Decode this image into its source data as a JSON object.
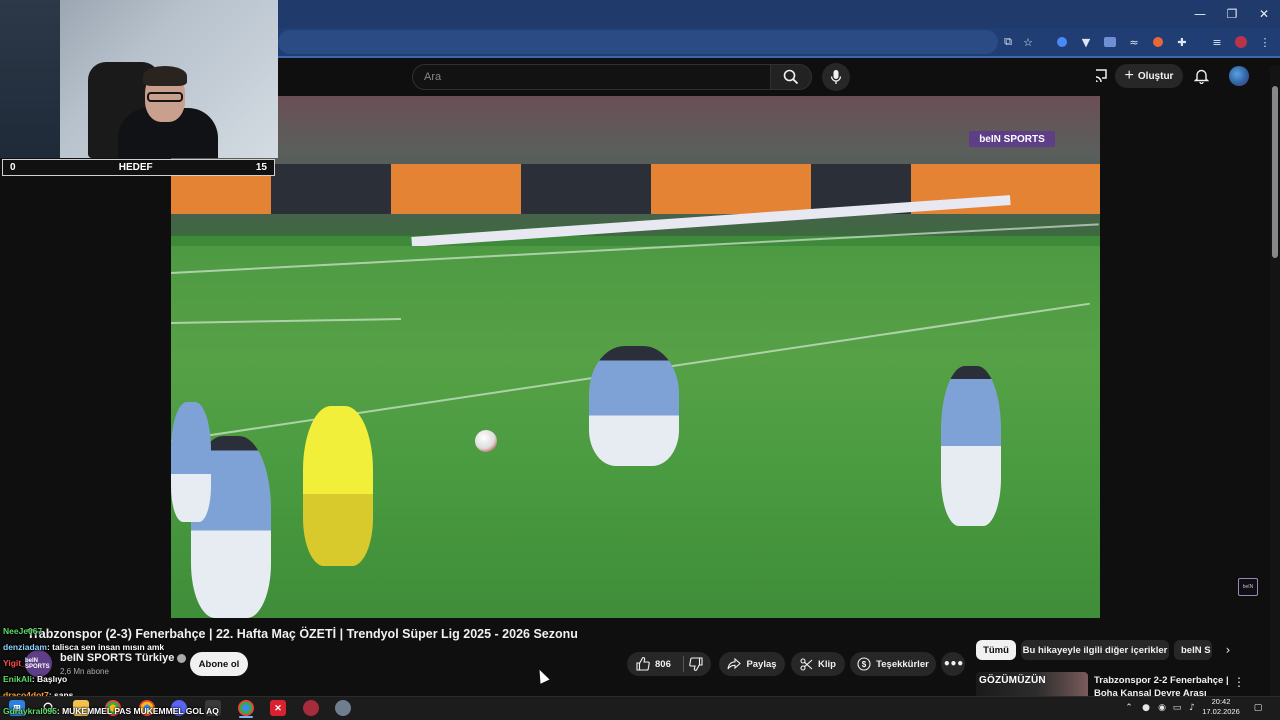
{
  "window": {
    "controls": [
      "—",
      "❐",
      "✕"
    ]
  },
  "youtube": {
    "search": {
      "placeholder": "Ara"
    },
    "create_label": "Oluştur"
  },
  "webcam": {
    "hedef": {
      "left": "0",
      "label": "HEDEF",
      "right": "15"
    }
  },
  "video": {
    "watermark": "beIN SPORTS",
    "title": "Trabzonspor (2-3) Fenerbahçe | 22. Hafta Maç ÖZETİ | Trendyol Süper Lig 2025 - 2026 Sezonu",
    "channel": {
      "name": "beIN SPORTS Türkiye",
      "subscribers": "2,6 Mn abone",
      "avatar_text": "beIN SPORTS",
      "subscribe_label": "Abone ol"
    },
    "actions": {
      "likes": "806",
      "share": "Paylaş",
      "clip": "Klip",
      "thanks": "Teşekkürler"
    }
  },
  "related": {
    "chips": [
      "Tümü",
      "Bu hikayeyle ilgili diğer içerikler",
      "beIN S"
    ],
    "items": [
      {
        "thumb_text": "GÖZÜMÜZÜN",
        "title": "Trabzonspor 2-2 Fenerbahçe | Boha Kansal Devre Arası"
      }
    ]
  },
  "chat": [
    {
      "user": "NeeJe067",
      "message": "",
      "color": "#5ddc6a"
    },
    {
      "user": "denziadam",
      "message": ": talisca sen insan mısın amk",
      "color": "#8fd3ff"
    },
    {
      "user": "Yigit_",
      "message": "",
      "color": "#ff4d4d"
    },
    {
      "user": "EnikAli",
      "message": ": Başlıyo",
      "color": "#5ddc6a"
    },
    {
      "user": "draco4dot7",
      "message": ": şans",
      "color": "#ff9f3a"
    },
    {
      "user": "Gdraykral095",
      "message": ": MUKEMMEL PAS MUKEMMEL GOL AQ",
      "color": "#5ddc6a"
    }
  ],
  "taskbar": {
    "time": "20:42",
    "date": "17.02.2026"
  },
  "colors": {
    "accent": "#3ea6ff",
    "youtube_bg": "#0f0f0f",
    "browser_frame": "#1f3a6b",
    "bein_purple": "#5f3e88"
  },
  "icons": [
    "search-icon",
    "mic-icon",
    "cast-icon",
    "bell-icon",
    "like-icon",
    "dislike-icon",
    "share-icon",
    "scissors-icon",
    "thanks-icon",
    "more-icon",
    "windows-icon",
    "chrome-icon"
  ]
}
